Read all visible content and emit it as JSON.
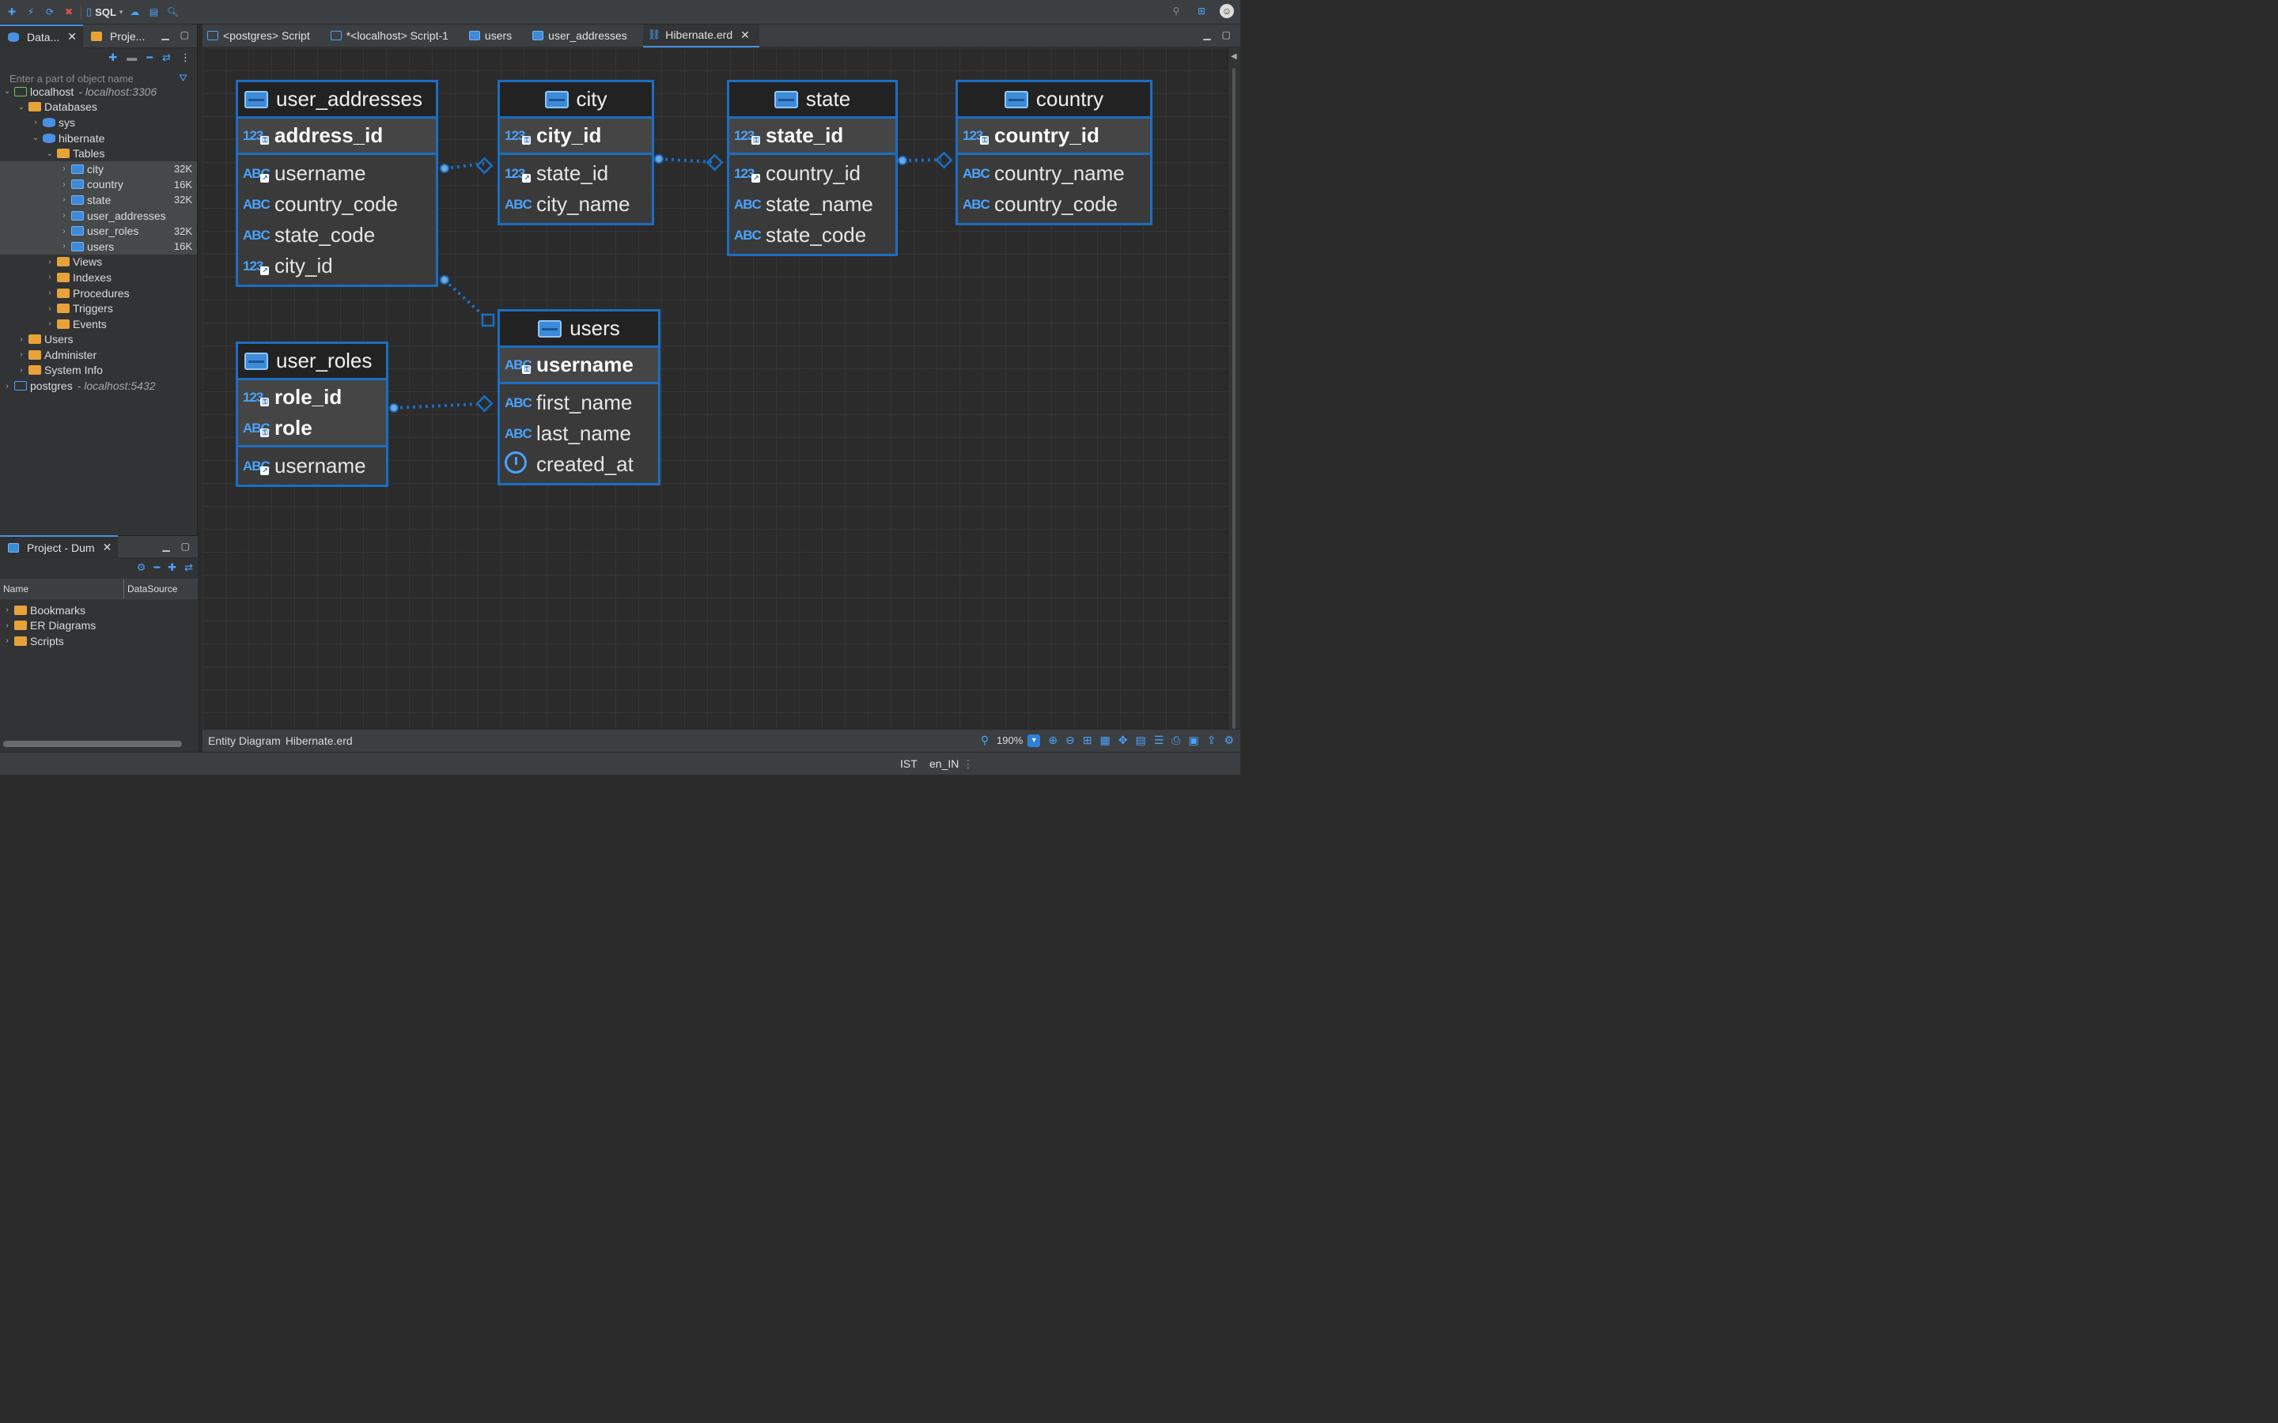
{
  "toolbar": {
    "sql_label": "SQL"
  },
  "left_tabs": [
    {
      "label": "Data...",
      "active": true
    },
    {
      "label": "Proje...",
      "active": false
    }
  ],
  "filter": {
    "placeholder": "Enter a part of object name"
  },
  "tree": {
    "localhost": {
      "label": "localhost",
      "host": "- localhost:3306"
    },
    "databases": "Databases",
    "sys": "sys",
    "hibernate": "hibernate",
    "tables": "Tables",
    "table_items": [
      {
        "label": "city",
        "size": "32K"
      },
      {
        "label": "country",
        "size": "16K"
      },
      {
        "label": "state",
        "size": "32K"
      },
      {
        "label": "user_addresses",
        "size": ""
      },
      {
        "label": "user_roles",
        "size": "32K"
      },
      {
        "label": "users",
        "size": "16K"
      }
    ],
    "views": "Views",
    "indexes": "Indexes",
    "procedures": "Procedures",
    "triggers": "Triggers",
    "events": "Events",
    "users": "Users",
    "administer": "Administer",
    "system_info": "System Info",
    "postgres": {
      "label": "postgres",
      "host": "- localhost:5432"
    }
  },
  "project_panel": {
    "tab": "Project - Dum",
    "col_name": "Name",
    "col_datasource": "DataSource",
    "items": [
      "Bookmarks",
      "ER Diagrams",
      "Scripts"
    ]
  },
  "editor_tabs": [
    {
      "label": "<postgres> Script"
    },
    {
      "label": "*<localhost> Script-1"
    },
    {
      "label": "users"
    },
    {
      "label": "user_addresses"
    },
    {
      "label": "Hibernate.erd"
    }
  ],
  "entities": {
    "user_addresses": {
      "title": "user_addresses",
      "pk": [
        {
          "type": "123",
          "name": "address_id"
        }
      ],
      "attrs": [
        {
          "type": "ABC",
          "name": "username"
        },
        {
          "type": "ABC",
          "name": "country_code"
        },
        {
          "type": "ABC",
          "name": "state_code"
        },
        {
          "type": "123",
          "name": "city_id"
        }
      ]
    },
    "city": {
      "title": "city",
      "pk": [
        {
          "type": "123",
          "name": "city_id"
        }
      ],
      "attrs": [
        {
          "type": "123",
          "name": "state_id"
        },
        {
          "type": "ABC",
          "name": "city_name"
        }
      ]
    },
    "state": {
      "title": "state",
      "pk": [
        {
          "type": "123",
          "name": "state_id"
        }
      ],
      "attrs": [
        {
          "type": "123",
          "name": "country_id"
        },
        {
          "type": "ABC",
          "name": "state_name"
        },
        {
          "type": "ABC",
          "name": "state_code"
        }
      ]
    },
    "country": {
      "title": "country",
      "pk": [
        {
          "type": "123",
          "name": "country_id"
        }
      ],
      "attrs": [
        {
          "type": "ABC",
          "name": "country_name"
        },
        {
          "type": "ABC",
          "name": "country_code"
        }
      ]
    },
    "user_roles": {
      "title": "user_roles",
      "pk": [
        {
          "type": "123",
          "name": "role_id"
        },
        {
          "type": "ABC",
          "name": "role"
        }
      ],
      "attrs": [
        {
          "type": "ABC",
          "name": "username"
        }
      ]
    },
    "users": {
      "title": "users",
      "pk": [
        {
          "type": "ABC",
          "name": "username"
        }
      ],
      "attrs": [
        {
          "type": "ABC",
          "name": "first_name"
        },
        {
          "type": "ABC",
          "name": "last_name"
        },
        {
          "type": "clock",
          "name": "created_at"
        }
      ]
    }
  },
  "diagram_status": {
    "label": "Entity Diagram",
    "file": "Hibernate.erd",
    "zoom": "190%"
  },
  "status": {
    "timezone": "IST",
    "locale": "en_IN"
  },
  "colors": {
    "accent": "#1b6ec2",
    "icon_blue": "#4aa3ff",
    "folder": "#e8a23a"
  }
}
